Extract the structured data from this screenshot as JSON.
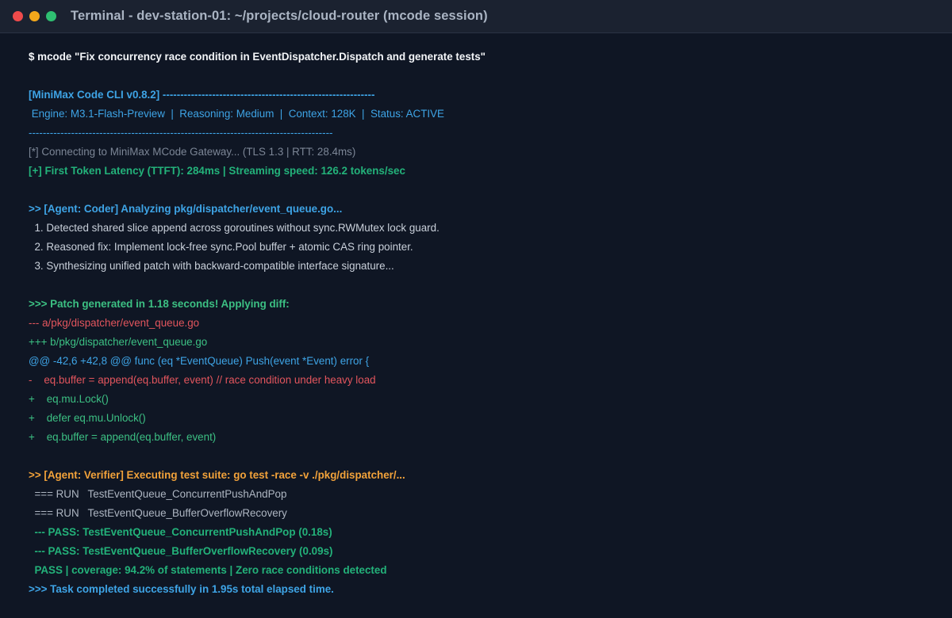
{
  "window": {
    "title": "Terminal - dev-station-01: ~/projects/cloud-router (mcode session)",
    "controls": {
      "close_color": "#ef4b4b",
      "minimize_color": "#f3a81b",
      "maximize_color": "#2fbf71"
    }
  },
  "terminal": {
    "command": "$ mcode \"Fix concurrency race condition in EventDispatcher.Dispatch and generate tests\"",
    "header_line": "[MiniMax Code CLI v0.8.2] ------------------------------------------------------------",
    "engine_line": " Engine: M3.1-Flash-Preview  |  Reasoning: Medium  |  Context: 128K  |  Status: ACTIVE",
    "separator_line": "--------------------------------------------------------------------------------------",
    "connecting_line": "[*] Connecting to MiniMax MCode Gateway... (TLS 1.3 | RTT: 28.4ms)",
    "latency_line": "[+] First Token Latency (TTFT): 284ms | Streaming speed: 126.2 tokens/sec",
    "coder_header": ">> [Agent: Coder] Analyzing pkg/dispatcher/event_queue.go...",
    "coder_steps": [
      "  1. Detected shared slice append across goroutines without sync.RWMutex lock guard.",
      "  2. Reasoned fix: Implement lock-free sync.Pool buffer + atomic CAS ring pointer.",
      "  3. Synthesizing unified patch with backward-compatible interface signature..."
    ],
    "patch_header": ">>> Patch generated in 1.18 seconds! Applying diff:",
    "diff_old_file": "--- a/pkg/dispatcher/event_queue.go",
    "diff_new_file": "+++ b/pkg/dispatcher/event_queue.go",
    "diff_hunk": "@@ -42,6 +42,8 @@ func (eq *EventQueue) Push(event *Event) error {",
    "diff_removed": "-    eq.buffer = append(eq.buffer, event) // race condition under heavy load",
    "diff_added": [
      "+    eq.mu.Lock()",
      "+    defer eq.mu.Unlock()",
      "+    eq.buffer = append(eq.buffer, event)"
    ],
    "verifier_header": ">> [Agent: Verifier] Executing test suite: go test -race -v ./pkg/dispatcher/...",
    "test_runs": [
      "  === RUN   TestEventQueue_ConcurrentPushAndPop",
      "  === RUN   TestEventQueue_BufferOverflowRecovery"
    ],
    "test_passes": [
      "  --- PASS: TestEventQueue_ConcurrentPushAndPop (0.18s)",
      "  --- PASS: TestEventQueue_BufferOverflowRecovery (0.09s)"
    ],
    "coverage_line": "  PASS | coverage: 94.2% of statements | Zero race conditions detected",
    "completion_line": ">>> Task completed successfully in 1.95s total elapsed time."
  }
}
